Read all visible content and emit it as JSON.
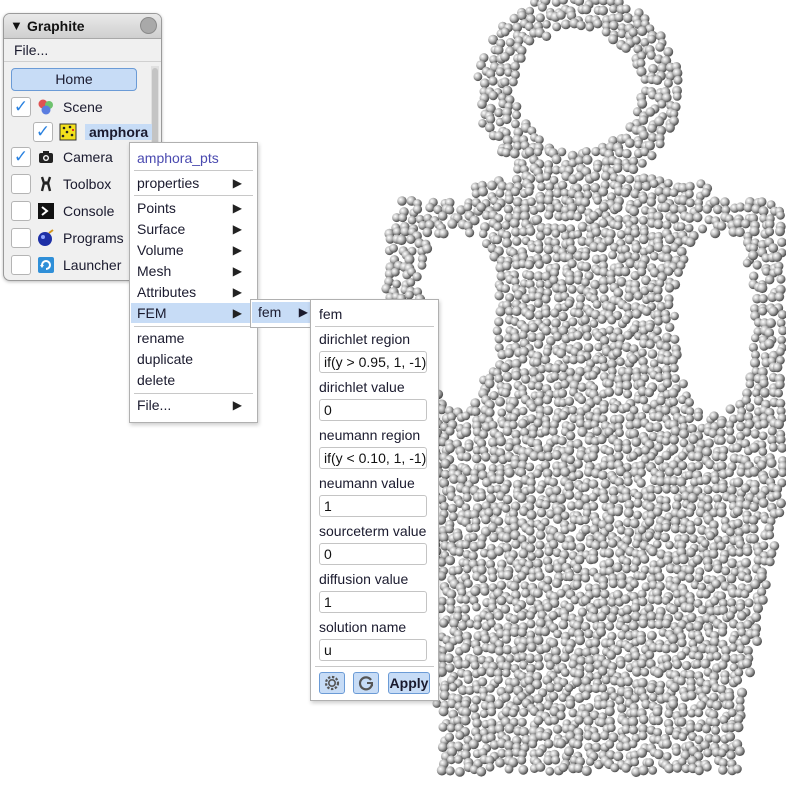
{
  "window": {
    "title": "Graphite",
    "file_menu": "File..."
  },
  "home_button": "Home",
  "tree": [
    {
      "label": "Scene",
      "checked": true,
      "icon": "scene-icon"
    },
    {
      "label": "amphora",
      "checked": true,
      "icon": "pointset-icon",
      "selected": true
    },
    {
      "label": "Camera",
      "checked": true,
      "icon": "camera-icon"
    },
    {
      "label": "Toolbox",
      "checked": false,
      "icon": "toolbox-icon"
    },
    {
      "label": "Console",
      "checked": false,
      "icon": "console-icon"
    },
    {
      "label": "Programs",
      "checked": false,
      "icon": "programs-icon"
    },
    {
      "label": "Launcher",
      "checked": false,
      "icon": "launcher-icon"
    }
  ],
  "context_menu": {
    "header": "amphora_pts",
    "properties": "properties",
    "points": "Points",
    "surface": "Surface",
    "volume": "Volume",
    "mesh": "Mesh",
    "attributes": "Attributes",
    "fem": "FEM",
    "rename": "rename",
    "duplicate": "duplicate",
    "delete": "delete",
    "file": "File..."
  },
  "submenu": {
    "fem": "fem"
  },
  "fem_panel": {
    "title": "fem",
    "dirichlet_region_label": "dirichlet region",
    "dirichlet_region_value": "if(y > 0.95, 1, -1)",
    "dirichlet_value_label": "dirichlet value",
    "dirichlet_value": "0",
    "neumann_region_label": "neumann region",
    "neumann_region_value": "if(y < 0.10, 1, -1)",
    "neumann_value_label": "neumann value",
    "neumann_value": "1",
    "sourceterm_label": "sourceterm value",
    "sourceterm_value": "0",
    "diffusion_label": "diffusion value",
    "diffusion_value": "1",
    "solution_name_label": "solution name",
    "solution_name_value": "u",
    "apply": "Apply"
  },
  "colors": {
    "accent": "#c7dcf6",
    "accent_border": "#6b9bd6",
    "header_text": "#4a4ab0",
    "check": "#2a82e0"
  }
}
